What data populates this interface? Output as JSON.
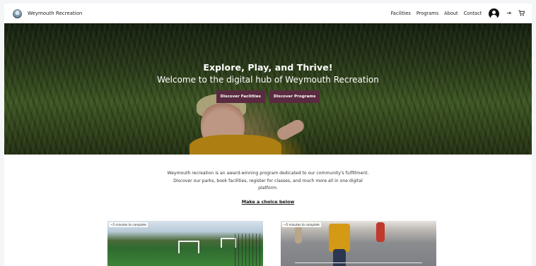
{
  "header": {
    "brand": "Weymouth Recreation",
    "nav": [
      "Facilities",
      "Programs",
      "About",
      "Contact"
    ],
    "icons": [
      "user-icon",
      "logout-icon",
      "cart-icon"
    ]
  },
  "hero": {
    "title": "Explore, Play, and Thrive!",
    "subtitle": "Welcome to the digital hub of Weymouth Recreation",
    "buttons": [
      "Discover Facilities",
      "Discover Programs"
    ]
  },
  "intro": {
    "text": "Weymouth recreation is an award-winning program dedicated to our community's fulfillment. Discover our parks, book facilities, register for classes, and much more all in one digital platform.",
    "link": "Make a choice below"
  },
  "cards": [
    {
      "badge": "~5 minutes to complete"
    },
    {
      "badge": "~5 minutes to complete"
    }
  ],
  "colors": {
    "accent": "#5a2b40",
    "hero_text": "#ffffff",
    "background": "#f4f5f7"
  }
}
